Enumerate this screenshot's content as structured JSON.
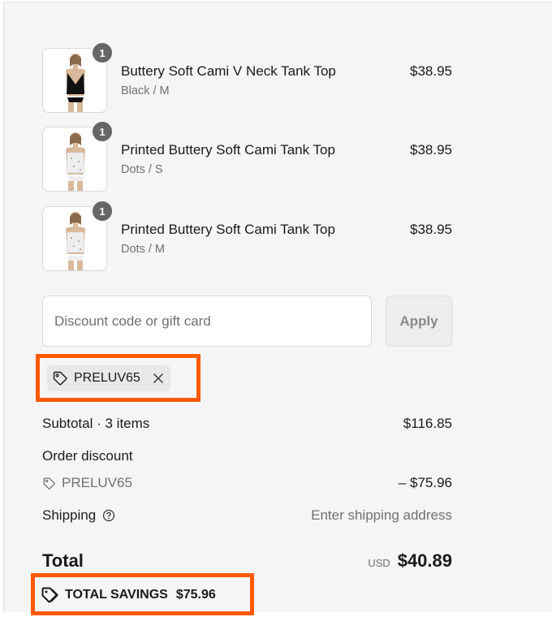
{
  "cart": {
    "items": [
      {
        "title": "Buttery Soft Cami V Neck Tank Top",
        "variant": "Black / M",
        "price": "$38.95",
        "quantity": "1",
        "image_color": "#111111"
      },
      {
        "title": "Printed Buttery Soft Cami Tank Top",
        "variant": "Dots / S",
        "price": "$38.95",
        "quantity": "1",
        "image_color": "#e9e9e9"
      },
      {
        "title": "Printed Buttery Soft Cami Tank Top",
        "variant": "Dots / M",
        "price": "$38.95",
        "quantity": "1",
        "image_color": "#e9e9e9"
      }
    ]
  },
  "discount": {
    "placeholder": "Discount code or gift card",
    "apply_label": "Apply",
    "applied_code": "PRELUV65"
  },
  "summary": {
    "subtotal_label": "Subtotal · 3 items",
    "subtotal_value": "$116.85",
    "order_discount_label": "Order discount",
    "discount_code": "PRELUV65",
    "discount_value": "– $75.96",
    "shipping_label": "Shipping",
    "shipping_value": "Enter shipping address",
    "total_label": "Total",
    "currency": "USD",
    "total_value": "$40.89",
    "savings_label": "TOTAL SAVINGS",
    "savings_value": "$75.96"
  },
  "colors": {
    "highlight": "#ff5a00",
    "badge": "#666666",
    "panel_bg": "#f5f5f5"
  }
}
